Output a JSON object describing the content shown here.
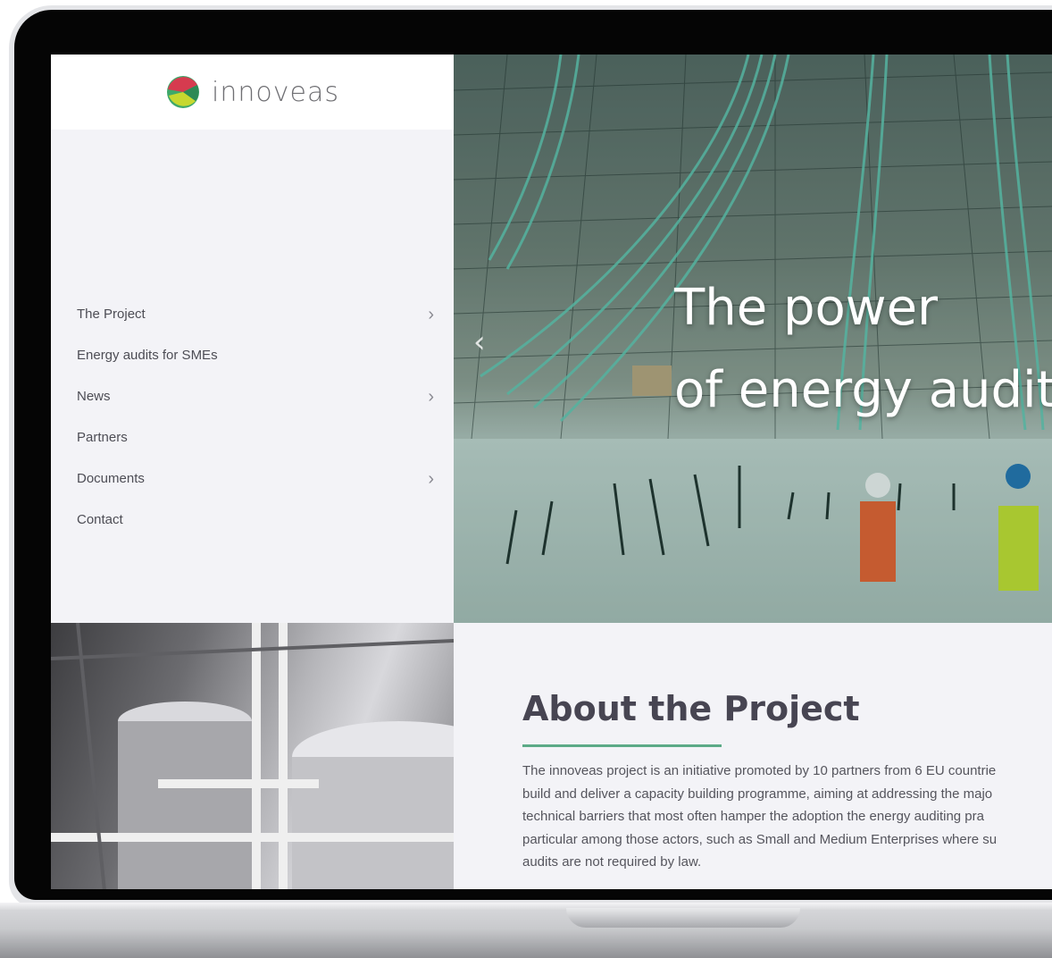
{
  "brand": {
    "name": "innoveas",
    "colors": {
      "accent": "#5caa87",
      "logo_red": "#d63b4f",
      "logo_green": "#3fa86a",
      "logo_yellow": "#c6d82f"
    }
  },
  "nav": {
    "items": [
      {
        "label": "The Project",
        "has_submenu": true,
        "icon": "chevron-right-icon"
      },
      {
        "label": "Energy audits for SMEs",
        "has_submenu": false
      },
      {
        "label": "News",
        "has_submenu": true,
        "icon": "chevron-right-icon"
      },
      {
        "label": "Partners",
        "has_submenu": false
      },
      {
        "label": "Documents",
        "has_submenu": true,
        "icon": "chevron-right-icon"
      },
      {
        "label": "Contact",
        "has_submenu": false
      }
    ],
    "chevron": "›"
  },
  "hero": {
    "title_line1": "The power",
    "title_line2": "of energy audit",
    "prev_arrow": "‹"
  },
  "about": {
    "title": "About the Project",
    "paragraph_lines": [
      "The innoveas project is an initiative promoted by 10 partners from 6 EU countrie",
      "build and deliver a capacity building programme, aiming at addressing the majo",
      "technical barriers that most often hamper the adoption the energy auditing pra",
      "particular among those actors, such as Small and Medium Enterprises where su",
      "audits are not required by law."
    ]
  }
}
